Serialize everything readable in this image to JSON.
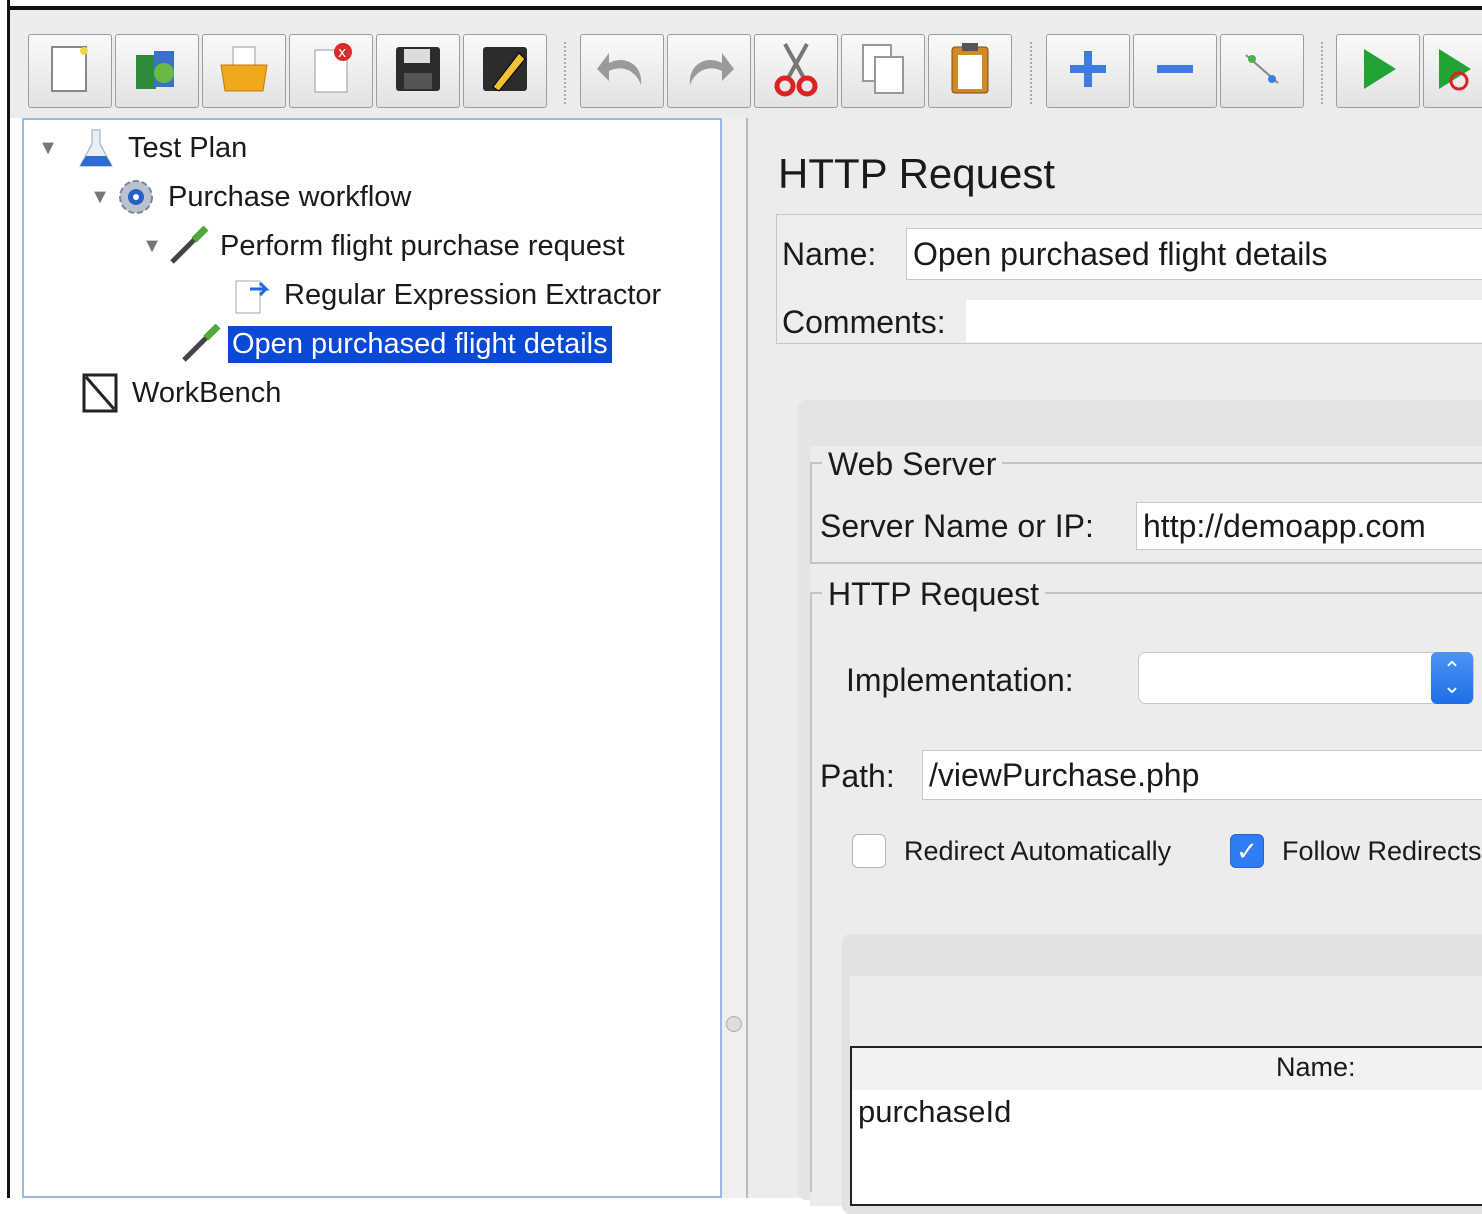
{
  "toolbar": {
    "buttons": [
      {
        "icon": "new-file-icon"
      },
      {
        "icon": "templates-icon"
      },
      {
        "icon": "open-folder-icon"
      },
      {
        "icon": "close-file-icon"
      },
      {
        "icon": "save-icon"
      },
      {
        "icon": "save-as-icon"
      },
      {
        "icon": "undo-icon"
      },
      {
        "icon": "redo-icon"
      },
      {
        "icon": "cut-icon"
      },
      {
        "icon": "copy-icon"
      },
      {
        "icon": "paste-icon"
      },
      {
        "icon": "expand-all-icon"
      },
      {
        "icon": "collapse-all-icon"
      },
      {
        "icon": "toggle-icon"
      },
      {
        "icon": "start-icon"
      },
      {
        "icon": "start-no-pauses-icon"
      }
    ]
  },
  "tree": {
    "items": [
      {
        "label": "Test Plan",
        "icon": "flask-icon",
        "expanded": true
      },
      {
        "label": "Purchase workflow",
        "icon": "gear-icon",
        "expanded": true
      },
      {
        "label": "Perform flight purchase request",
        "icon": "pipette-icon",
        "expanded": true
      },
      {
        "label": "Regular Expression Extractor",
        "icon": "extractor-icon"
      },
      {
        "label": "Open purchased flight details",
        "icon": "pipette-icon",
        "selected": true
      },
      {
        "label": "WorkBench",
        "icon": "workbench-icon"
      }
    ]
  },
  "panel": {
    "title": "HTTP Request",
    "name_label": "Name:",
    "name_value": "Open purchased flight details",
    "comments_label": "Comments:",
    "comments_value": "",
    "web_server": {
      "legend": "Web Server",
      "server_label": "Server Name or IP:",
      "server_value": "http://demoapp.com"
    },
    "http_request": {
      "legend": "HTTP Request",
      "implementation_label": "Implementation:",
      "implementation_value": "",
      "path_label": "Path:",
      "path_value": "/viewPurchase.php",
      "redirect_auto_label": "Redirect Automatically",
      "redirect_auto_checked": false,
      "follow_redirects_label": "Follow Redirects",
      "follow_redirects_checked": true
    },
    "parameters": {
      "column_name": "Name:",
      "rows": [
        "purchaseId"
      ]
    }
  },
  "colors": {
    "selection": "#0a48d6",
    "checkbox_checked": "#2f7cf5",
    "run_green": "#21a336"
  }
}
